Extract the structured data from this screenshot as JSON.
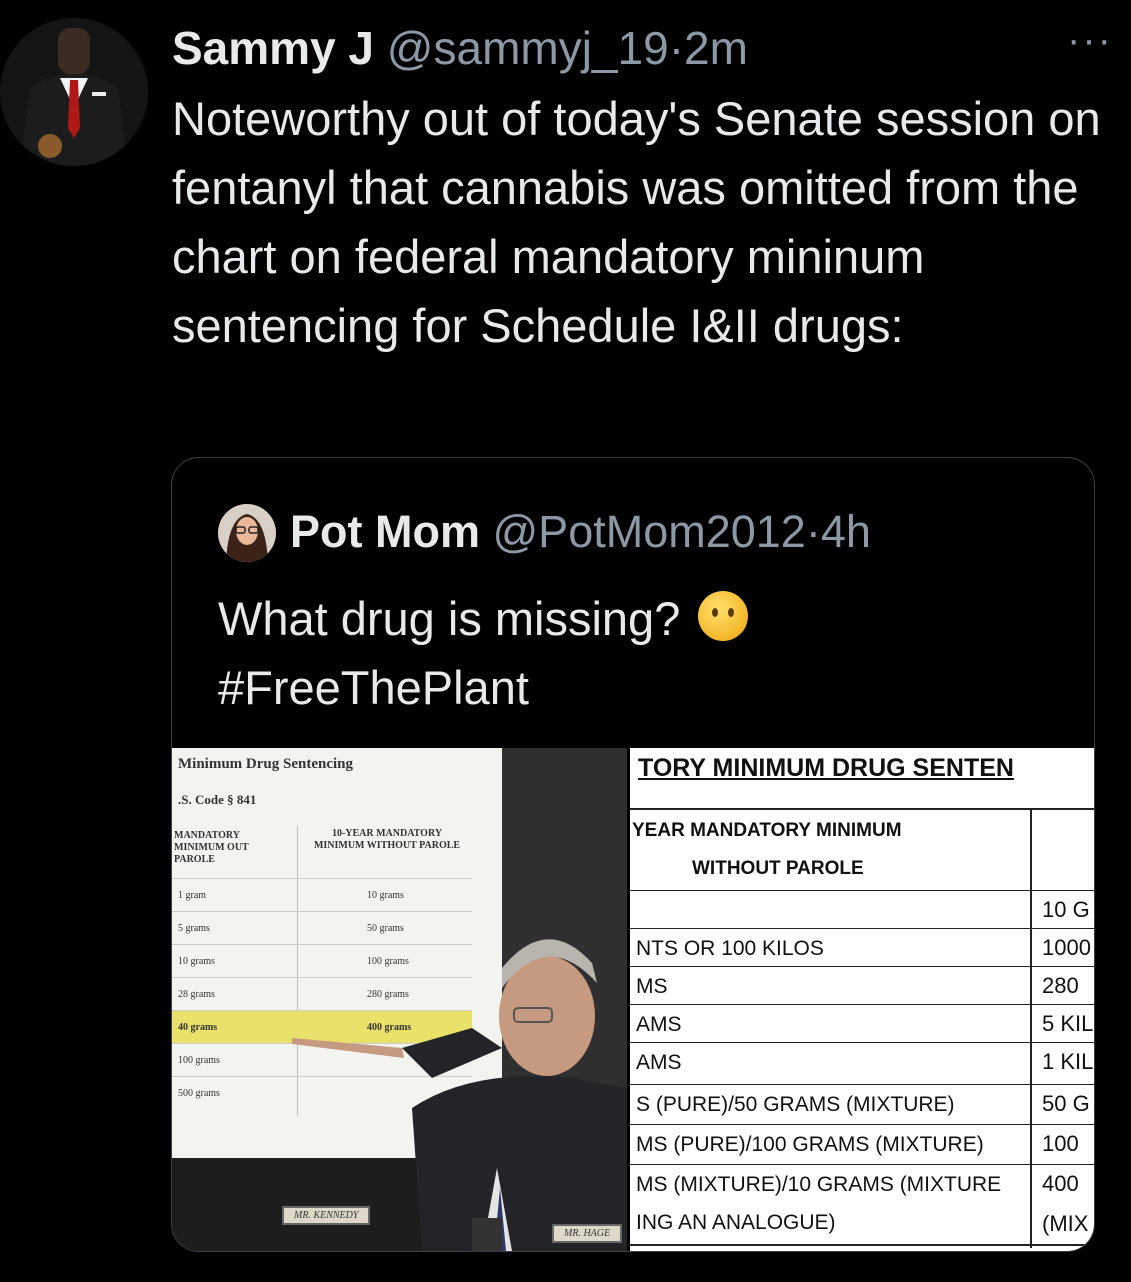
{
  "tweet": {
    "name": "Sammy J",
    "handle": "@sammyj_19",
    "separator": "·",
    "time": "2m",
    "more_label": "···",
    "text": "Noteworthy out of today's Senate session on fentanyl that cannabis was omitted from the chart on federal mandatory mininum sentencing for Schedule I&II drugs:"
  },
  "quote": {
    "name": "Pot Mom",
    "handle": "@PotMom2012",
    "separator": "·",
    "time": "4h",
    "text_line1": "What drug is missing?",
    "text_line2": "#FreeThePlant",
    "emoji": "thinking-face-icon"
  },
  "left_image": {
    "title": "Minimum Drug Sentencing",
    "subtitle": ".S. Code § 841",
    "col1_header": "MANDATORY MINIMUM OUT PAROLE",
    "col2_header": "10-YEAR MANDATORY MINIMUM WITHOUT PAROLE",
    "rows": [
      {
        "c1": "1 gram",
        "c2": "10 grams"
      },
      {
        "c1": "5 grams",
        "c2": "50 grams"
      },
      {
        "c1": "10 grams",
        "c2": "100 grams"
      },
      {
        "c1": "28 grams",
        "c2": "280 grams"
      },
      {
        "c1": "40 grams",
        "c2": "400 grams"
      },
      {
        "c1": "100 grams",
        "c2": ""
      },
      {
        "c1": "500 grams",
        "c2": ""
      }
    ],
    "nameplate1": "MR. KENNEDY",
    "nameplate2": "MR. HAGE"
  },
  "right_image": {
    "title": "TORY MINIMUM DRUG SENTEN",
    "header_line1": "YEAR MANDATORY MINIMUM",
    "header_line2": "WITHOUT PAROLE",
    "rows": [
      {
        "a": "",
        "b": "10 G"
      },
      {
        "a": "NTS OR 100 KILOS",
        "b": "1000"
      },
      {
        "a": "MS",
        "b": "280"
      },
      {
        "a": "AMS",
        "b": "5 KIL"
      },
      {
        "a": "AMS",
        "b": "1 KIL"
      },
      {
        "a": "S (PURE)/50 GRAMS (MIXTURE)",
        "b": "50 G"
      },
      {
        "a": "MS (PURE)/100 GRAMS (MIXTURE)",
        "b": "100"
      },
      {
        "a": "MS (MIXTURE)/10 GRAMS (MIXTURE",
        "b": "400"
      },
      {
        "a": "ING AN ANALOGUE)",
        "b": "(MIX"
      }
    ]
  }
}
